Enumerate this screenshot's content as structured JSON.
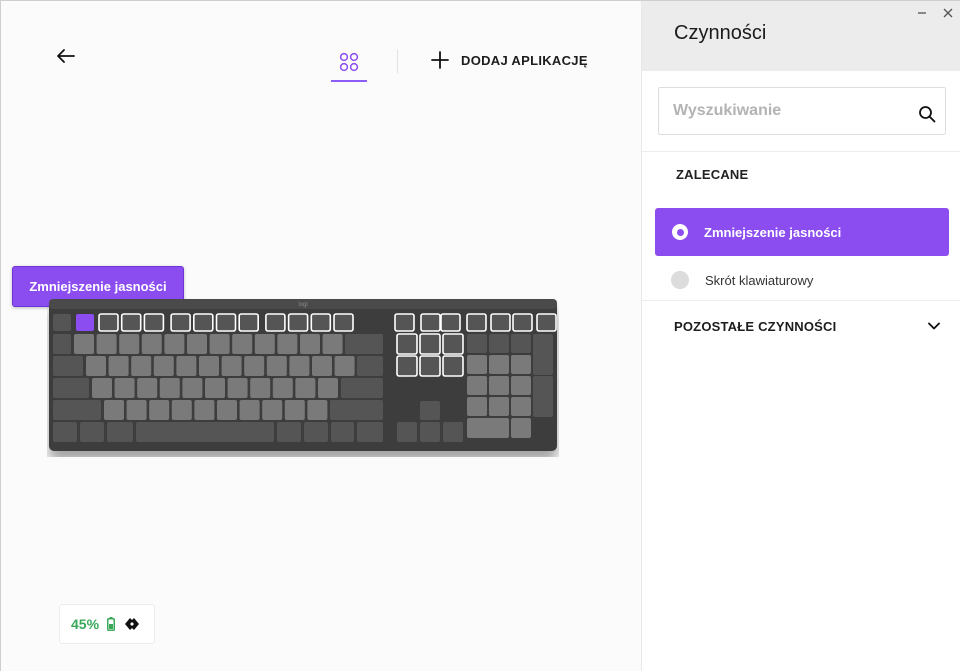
{
  "header": {
    "add_app_label": "DODAJ APLIKACJĘ"
  },
  "device": {
    "battery_percent": "45%",
    "selected_key_callout": "Zmniejszenie jasności"
  },
  "keyboard": {
    "brand_mark": "logi"
  },
  "panel": {
    "title": "Czynności",
    "search_placeholder": "Wyszukiwanie",
    "recommended_heading": "ZALECANE",
    "options": [
      {
        "label": "Zmniejszenie jasności",
        "selected": true
      },
      {
        "label": "Skrót klawiaturowy",
        "selected": false
      }
    ],
    "other_actions_heading": "POZOSTAŁE CZYNNOŚCI"
  },
  "colors": {
    "accent": "#8b4df0",
    "battery_green": "#3aa85a",
    "keyboard_body": "#3c3c3c",
    "key_dark": "#555555",
    "key_light": "#7a7a7a"
  },
  "icons": {
    "back": "arrow-left-icon",
    "apps": "apps-grid-icon",
    "add": "plus-icon",
    "search": "search-icon",
    "expand": "chevron-down-icon",
    "battery": "battery-icon",
    "connection": "logi-bolt-icon",
    "minimize": "minimize-icon",
    "close": "close-icon"
  }
}
